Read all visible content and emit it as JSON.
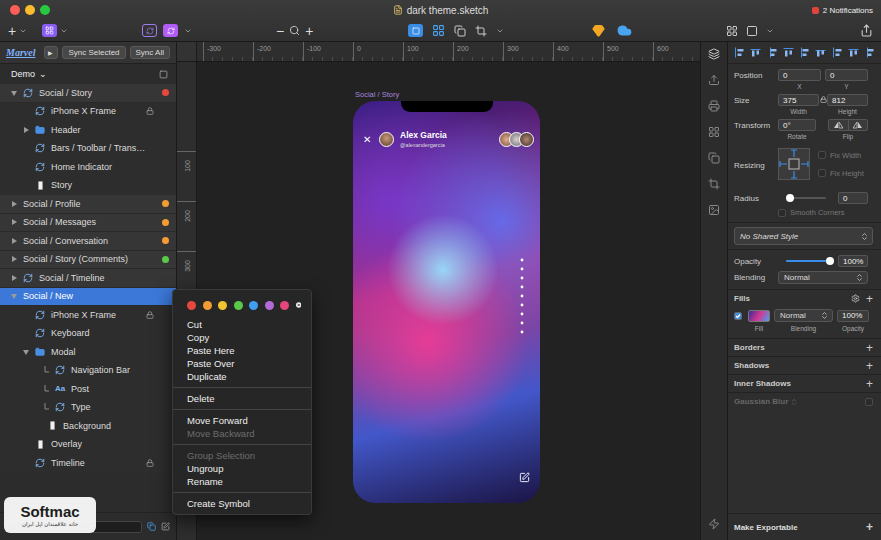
{
  "window": {
    "title": "dark theme.sketch",
    "notifications": "2 Notifications"
  },
  "toolbar": {
    "insert": "+",
    "zoom_out": "−",
    "zoom_in": "+"
  },
  "plugin": {
    "logo": "Marvel",
    "play": "▶",
    "buttons": [
      "Sync Selected",
      "Sync All"
    ]
  },
  "page": {
    "name": "Demo",
    "chevron": "⌄"
  },
  "layers": [
    {
      "name": "Social / Story",
      "depth": 0,
      "kind": "symbol-master",
      "expanded": true,
      "selected": false,
      "locked": false,
      "masked": false,
      "color": "#e5483f"
    },
    {
      "name": "iPhone X Frame",
      "depth": 1,
      "kind": "symbol",
      "expanded": false,
      "selected": false,
      "locked": true,
      "masked": false
    },
    {
      "name": "Header",
      "depth": 1,
      "kind": "group",
      "expanded": false,
      "selected": false,
      "locked": false,
      "masked": false
    },
    {
      "name": "Bars / Toolbar / Trans…",
      "depth": 1,
      "kind": "symbol",
      "expanded": false,
      "selected": false,
      "locked": false,
      "masked": false
    },
    {
      "name": "Home Indicator",
      "depth": 1,
      "kind": "symbol",
      "expanded": false,
      "selected": false,
      "locked": false,
      "masked": false
    },
    {
      "name": "Story",
      "depth": 1,
      "kind": "shape",
      "expanded": false,
      "selected": false,
      "locked": false,
      "masked": false
    },
    {
      "name": "Social / Profile",
      "depth": 0,
      "kind": "artboard",
      "expanded": false,
      "selected": false,
      "locked": false,
      "masked": false,
      "color": "#f39c33"
    },
    {
      "name": "Social / Messages",
      "depth": 0,
      "kind": "artboard",
      "expanded": false,
      "selected": false,
      "locked": false,
      "masked": false,
      "color": "#f39c33"
    },
    {
      "name": "Social / Conversation",
      "depth": 0,
      "kind": "artboard",
      "expanded": false,
      "selected": false,
      "locked": false,
      "masked": false,
      "color": "#f39c33"
    },
    {
      "name": "Social / Story (Comments)",
      "depth": 0,
      "kind": "artboard",
      "expanded": false,
      "selected": false,
      "locked": false,
      "masked": false,
      "color": "#5ac94a"
    },
    {
      "name": "Social / Timeline",
      "depth": 0,
      "kind": "symbol-master",
      "expanded": false,
      "selected": false,
      "locked": false,
      "masked": false
    },
    {
      "name": "Social / New",
      "depth": 0,
      "kind": "artboard",
      "expanded": true,
      "selected": true,
      "locked": false,
      "masked": false
    },
    {
      "name": "iPhone X Frame",
      "depth": 1,
      "kind": "symbol",
      "expanded": false,
      "selected": false,
      "locked": true,
      "masked": false
    },
    {
      "name": "Keyboard",
      "depth": 1,
      "kind": "symbol",
      "expanded": false,
      "selected": false,
      "locked": false,
      "masked": false
    },
    {
      "name": "Modal",
      "depth": 1,
      "kind": "group",
      "expanded": true,
      "selected": false,
      "locked": false,
      "masked": false
    },
    {
      "name": "Navigation Bar",
      "depth": 2,
      "kind": "symbol",
      "expanded": false,
      "selected": false,
      "locked": false,
      "masked": true
    },
    {
      "name": "Post",
      "depth": 2,
      "kind": "text",
      "glyph": "Aa",
      "expanded": false,
      "selected": false,
      "locked": false,
      "masked": true
    },
    {
      "name": "Type",
      "depth": 2,
      "kind": "symbol",
      "expanded": false,
      "selected": false,
      "locked": false,
      "masked": true
    },
    {
      "name": "Background",
      "depth": 2,
      "kind": "shape",
      "expanded": false,
      "selected": false,
      "locked": false,
      "masked": false
    },
    {
      "name": "Overlay",
      "depth": 1,
      "kind": "shape",
      "expanded": false,
      "selected": false,
      "locked": false,
      "masked": false
    },
    {
      "name": "Timeline",
      "depth": 1,
      "kind": "symbol",
      "expanded": false,
      "selected": false,
      "locked": true,
      "masked": false
    }
  ],
  "menu": {
    "colors": [
      "#e5483f",
      "#f39c33",
      "#f0c530",
      "#5ac94a",
      "#3f9ff0",
      "#b36ad9",
      "#e6467a"
    ],
    "items": [
      {
        "kind": "item",
        "label": "Cut",
        "disabled": false
      },
      {
        "kind": "item",
        "label": "Copy",
        "disabled": false
      },
      {
        "kind": "item",
        "label": "Paste Here",
        "disabled": false
      },
      {
        "kind": "item",
        "label": "Paste Over",
        "disabled": false
      },
      {
        "kind": "item",
        "label": "Duplicate",
        "disabled": false
      },
      {
        "kind": "separator"
      },
      {
        "kind": "item",
        "label": "Delete",
        "disabled": false
      },
      {
        "kind": "separator"
      },
      {
        "kind": "item",
        "label": "Move Forward",
        "disabled": false
      },
      {
        "kind": "item",
        "label": "Move Backward",
        "disabled": true
      },
      {
        "kind": "separator"
      },
      {
        "kind": "item",
        "label": "Group Selection",
        "disabled": true
      },
      {
        "kind": "item",
        "label": "Ungroup",
        "disabled": false
      },
      {
        "kind": "item",
        "label": "Rename",
        "disabled": false
      },
      {
        "kind": "separator"
      },
      {
        "kind": "item",
        "label": "Create Symbol",
        "disabled": false
      }
    ]
  },
  "rulers": {
    "horizontal": [
      "-300",
      "-200",
      "-100",
      "0",
      "100",
      "200",
      "300",
      "400",
      "500",
      "600"
    ],
    "vertical": [
      "100",
      "200",
      "300"
    ]
  },
  "artboard": {
    "label": "Social / Story",
    "close": "✕",
    "user": "Alex Garcia",
    "handle": "@alexandergarcia"
  },
  "inspector": {
    "add": "+",
    "position": {
      "label": "Position",
      "x": "0",
      "y": "0",
      "x_label": "X",
      "y_label": "Y"
    },
    "size": {
      "label": "Size",
      "width": "375",
      "height": "812",
      "width_label": "Width",
      "height_label": "Height",
      "locked": true
    },
    "transform": {
      "label": "Transform",
      "rotate": "0°",
      "rotate_label": "Rotate",
      "flip_label": "Flip"
    },
    "resizing": {
      "label": "Resizing",
      "options": [
        {
          "label": "Fix Width",
          "checked": false,
          "disabled": true
        },
        {
          "label": "Fix Height",
          "checked": false,
          "disabled": true
        }
      ]
    },
    "radius": {
      "label": "Radius",
      "level": 0,
      "value": "0",
      "smooth": {
        "label": "Smooth Corners",
        "checked": false,
        "disabled": true
      }
    },
    "shared_style": "No Shared Style",
    "opacity": {
      "label": "Opacity",
      "level": 1,
      "value": "100%"
    },
    "blending": {
      "label": "Blending",
      "value": "Normal"
    },
    "fills": {
      "label": "Fills",
      "items": [
        {
          "enabled": true,
          "blending": "Normal",
          "opacity": "100%"
        }
      ],
      "labels": [
        "Fill",
        "Blending",
        "Opacity"
      ]
    },
    "sections": [
      {
        "label": "Borders",
        "disabled": false
      },
      {
        "label": "Shadows",
        "disabled": false
      },
      {
        "label": "Inner Shadows",
        "disabled": false
      },
      {
        "label": "Gaussian Blur",
        "disabled": true,
        "checked": false
      }
    ],
    "export": "Make Exportable"
  },
  "watermark": {
    "brand": "Softmac",
    "tagline": "خانه علاقمندان اپل ایران"
  }
}
